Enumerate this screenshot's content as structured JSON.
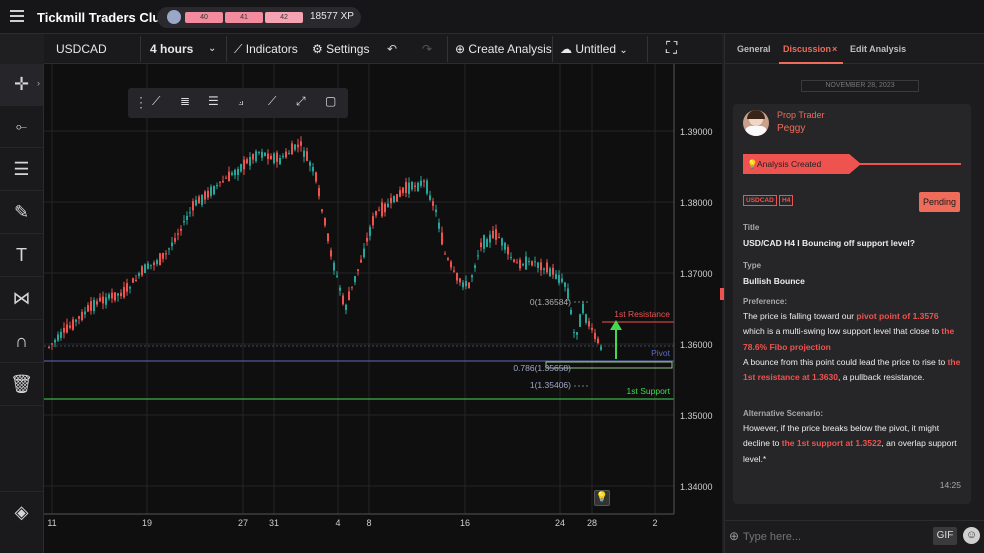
{
  "app": {
    "title": "Tickmill Traders Club",
    "xp_segments": [
      "40",
      "41",
      "42"
    ],
    "xp_text": "18577 XP"
  },
  "toolbar": {
    "symbol": "USDCAD",
    "timeframe": "4 hours",
    "indicators": "Indicators",
    "settings": "Settings",
    "create_analysis": "Create Analysis",
    "untitled": "Untitled"
  },
  "chart": {
    "y_ticks": [
      "1.39000",
      "1.38000",
      "1.37000",
      "1.36000",
      "1.35000",
      "1.34000"
    ],
    "x_ticks": [
      "11",
      "19",
      "27",
      "31",
      "4",
      "8",
      "16",
      "24",
      "28",
      "2"
    ],
    "price_tags": {
      "resistance": "1.36301",
      "current_a": "1.35959",
      "current_b": "1.35950",
      "pivot": "1.35761",
      "support": "1.35223"
    },
    "fib_labels": [
      "0(1.36584)",
      "0.786(1.35658)",
      "1(1.35406)"
    ],
    "line_labels": {
      "resistance": "1st Resistance",
      "pivot": "Pivot",
      "support": "1st Support"
    },
    "colors": {
      "up": "#26a69a",
      "down": "#ef5350",
      "resistance": "#ef5350",
      "pivot": "#5c6bc0",
      "support": "#43d94f"
    }
  },
  "panel": {
    "tabs": [
      "General",
      "Discussion",
      "Edit Analysis"
    ],
    "close_glyph": "×",
    "date": "NOVEMBER 28, 2023",
    "author_role": "Prop Trader",
    "author_name": "Peggy",
    "event": "Analysis Created",
    "tags": [
      "USDCAD",
      "H4"
    ],
    "status": "Pending",
    "title_label": "Title",
    "title": "USD/CAD H4 I Bouncing off support level?",
    "type_label": "Type",
    "type": "Bullish Bounce",
    "pref_label": "Preference:",
    "pref": {
      "p1": "The price is falling toward our ",
      "h1": "pivot point of 1.3576",
      "p2": " which is a multi-swing low support level that close to ",
      "h2": "the 78.6% Fibo projection",
      "p3": "A bounce from this point could lead the price to rise to ",
      "h3": "the 1st resistance at 1.3630",
      "p4": ", a pullback resistance."
    },
    "alt_label": "Alternative Scenario:",
    "alt": {
      "p1": "However, if the price breaks below the pivot, it might decline to ",
      "h1": "the 1st support at 1.3522",
      "p2": ", an overlap support level.*"
    },
    "time": "14:25",
    "input_placeholder": "Type here...",
    "gif": "GIF"
  }
}
